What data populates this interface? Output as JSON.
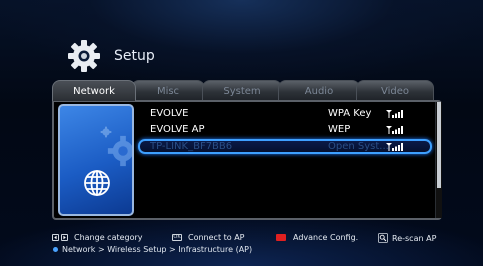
{
  "header": {
    "title": "Setup",
    "icon": "gear-icon"
  },
  "tabs": [
    {
      "label": "Network",
      "active": true
    },
    {
      "label": "Misc",
      "active": false
    },
    {
      "label": "System",
      "active": false
    },
    {
      "label": "Audio",
      "active": false
    },
    {
      "label": "Video",
      "active": false
    }
  ],
  "networks": [
    {
      "ssid": "EVOLVE",
      "security": "WPA Key",
      "selected": false
    },
    {
      "ssid": "EVOLVE AP",
      "security": "WEP",
      "selected": false
    },
    {
      "ssid": "TP-LINK_BF7BB6",
      "security": "Open Syst...",
      "selected": true
    }
  ],
  "footer": {
    "change_category": "Change category",
    "connect_to_ap": "Connect to AP",
    "advance_config": "Advance Config.",
    "rescan_ap": "Re-scan AP",
    "breadcrumb": "Network > Wireless Setup > Infrastructure (AP)"
  },
  "colors": {
    "selection_border": "#3ea0ff",
    "side_card": "#1b5cc4",
    "red_key": "#e02020",
    "signal": "#ffffff"
  }
}
